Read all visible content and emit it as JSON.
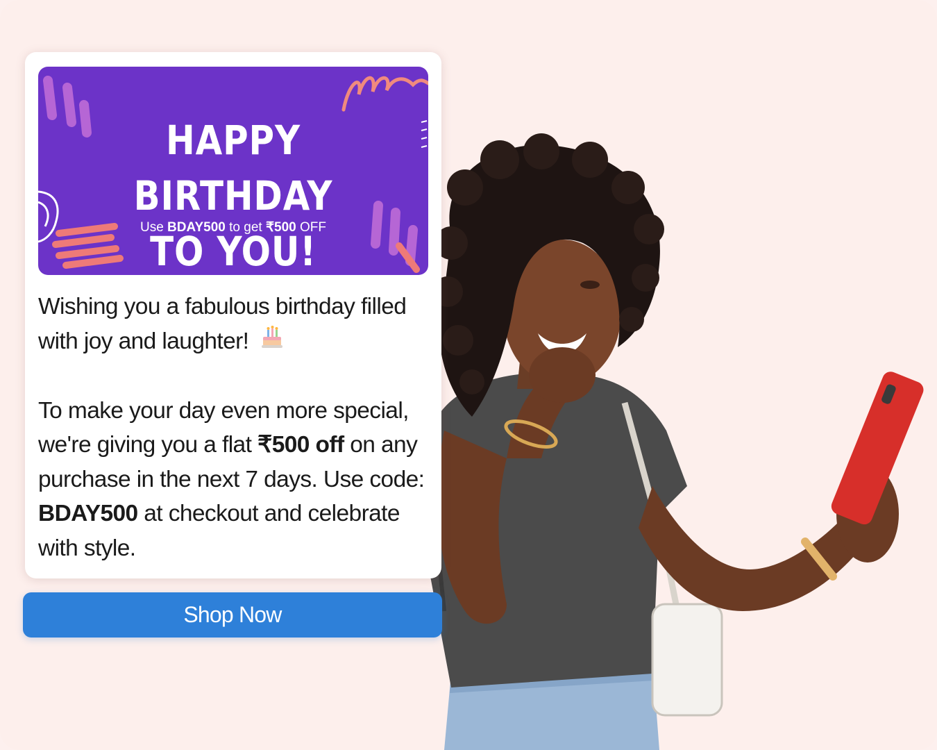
{
  "banner": {
    "title": "HAPPY BIRTHDAY\nTO YOU!",
    "code_prefix": "Use",
    "code": "BDAY500",
    "code_middle": "to get",
    "amount": "₹500",
    "code_suffix": "OFF"
  },
  "message": {
    "line1": "Wishing you a fabulous birthday filled with joy and laughter!",
    "emoji_icon": "birthday-cake-icon",
    "p2_part1": "To make your day even more special, we're giving you a flat",
    "p2_bold1": "₹500 off",
    "p2_part2": "on any purchase in the next 7 days. Use code:",
    "p2_bold2": "BDAY500",
    "p2_part3": "at checkout and celebrate with style."
  },
  "cta": {
    "label": "Shop Now"
  },
  "colors": {
    "background": "#fdefec",
    "banner": "#6c33c8",
    "button": "#2e80d9"
  }
}
